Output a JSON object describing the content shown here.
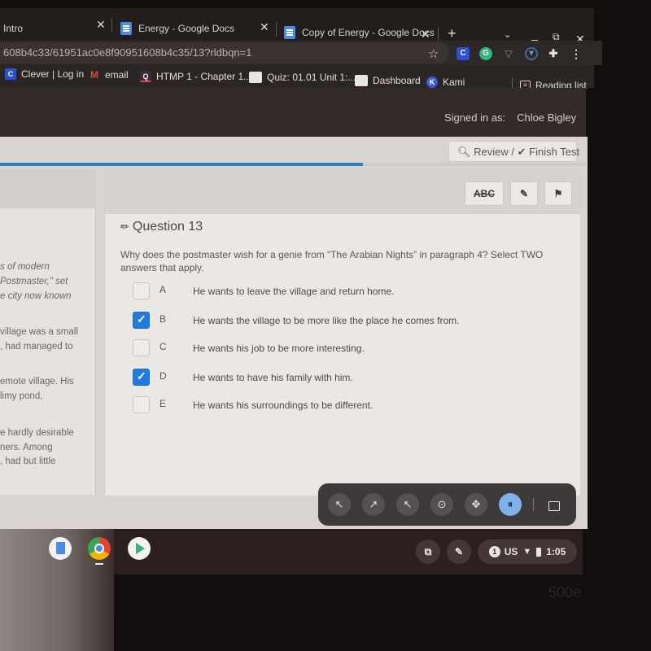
{
  "browser": {
    "tabs": [
      {
        "label": "Intro",
        "icon": "none"
      },
      {
        "label": "Energy - Google Docs",
        "icon": "google-docs-icon"
      },
      {
        "label": "Copy of Energy - Google Docs",
        "icon": "google-docs-icon"
      }
    ],
    "new_tab_label": "+",
    "url": "608b4c33/61951ac0e8f90951608b4c35/13?rldbqn=1",
    "extensions": [
      "clever-icon",
      "grammarly-icon",
      "vpn-icon",
      "shield-icon",
      "extensions-puzzle-icon",
      "kebab-menu-icon"
    ],
    "extension_labels": {
      "clever": "C",
      "grammarly": "G"
    },
    "bookmarks": [
      {
        "label": "Clever | Log in",
        "icon": "clever-icon",
        "icon_text": "C"
      },
      {
        "label": "email",
        "icon": "gmail-icon",
        "icon_text": "M"
      },
      {
        "label": "HTMP 1 - Chapter 1...",
        "icon": "quizlet-icon",
        "icon_text": "Q"
      },
      {
        "label": "Quiz: 01.01 Unit 1:...",
        "icon": "page-icon",
        "icon_text": ""
      },
      {
        "label": "Dashboard",
        "icon": "page-icon",
        "icon_text": ""
      },
      {
        "label": "Kami",
        "icon": "kami-icon",
        "icon_text": "K"
      }
    ],
    "reading_list_label": "Reading list",
    "colors": {
      "docs_blue": "#4a8be8",
      "clever_blue": "#2c4fd8",
      "grammarly_green": "#2fb582",
      "kami_blue": "#3b5bdb"
    }
  },
  "header": {
    "signed_in_label": "Signed in as:",
    "user_name": "Chloe Bigley",
    "review_label": "Review /",
    "finish_label": "Finish Test"
  },
  "progress": {
    "fraction": 0.62,
    "color": "#2a7fc0"
  },
  "passage": {
    "lines": [
      {
        "text": "s of modern",
        "italic": true
      },
      {
        "text": " Postmaster,\" set",
        "italic": true
      },
      {
        "text": "e city now known",
        "italic": true
      },
      {
        "text": "village was a small",
        "italic": false
      },
      {
        "text": ", had managed to",
        "italic": false
      },
      {
        "text": "emote village. His",
        "italic": false
      },
      {
        "text": "limy pond,",
        "italic": false
      },
      {
        "text": "e hardly desirable",
        "italic": false
      },
      {
        "text": "ners. Among",
        "italic": false
      },
      {
        "text": ", had but little",
        "italic": false
      }
    ]
  },
  "question": {
    "toolbar": {
      "strikethrough_label": "ABC",
      "note_icon": "edit-note-icon",
      "flag_icon": "flag-icon"
    },
    "title": "Question 13",
    "prompt": "Why does the postmaster wish for a genie from “The Arabian Nights” in paragraph 4? Select TWO answers that apply.",
    "choices": [
      {
        "letter": "A",
        "text": "He wants to leave the village and return home.",
        "checked": false
      },
      {
        "letter": "B",
        "text": "He wants the village to be more like the place he comes from.",
        "checked": true
      },
      {
        "letter": "C",
        "text": "He wants his job to be more interesting.",
        "checked": false
      },
      {
        "letter": "D",
        "text": "He wants to have his family with him.",
        "checked": true
      },
      {
        "letter": "E",
        "text": "He wants his surroundings to be different.",
        "checked": false
      }
    ]
  },
  "floating_toolbar": {
    "buttons": [
      "click-icon",
      "double-click-icon",
      "right-click-icon",
      "drag-icon",
      "move-icon",
      "pause-icon"
    ],
    "dock_icon": "dock-window-icon"
  },
  "shelf": {
    "apps": [
      "google-docs-app-icon",
      "chrome-app-icon",
      "play-store-app-icon"
    ],
    "tray": {
      "notification_count": "1",
      "keyboard_layout": "US",
      "time": "1:05"
    }
  },
  "watermark": "500e"
}
